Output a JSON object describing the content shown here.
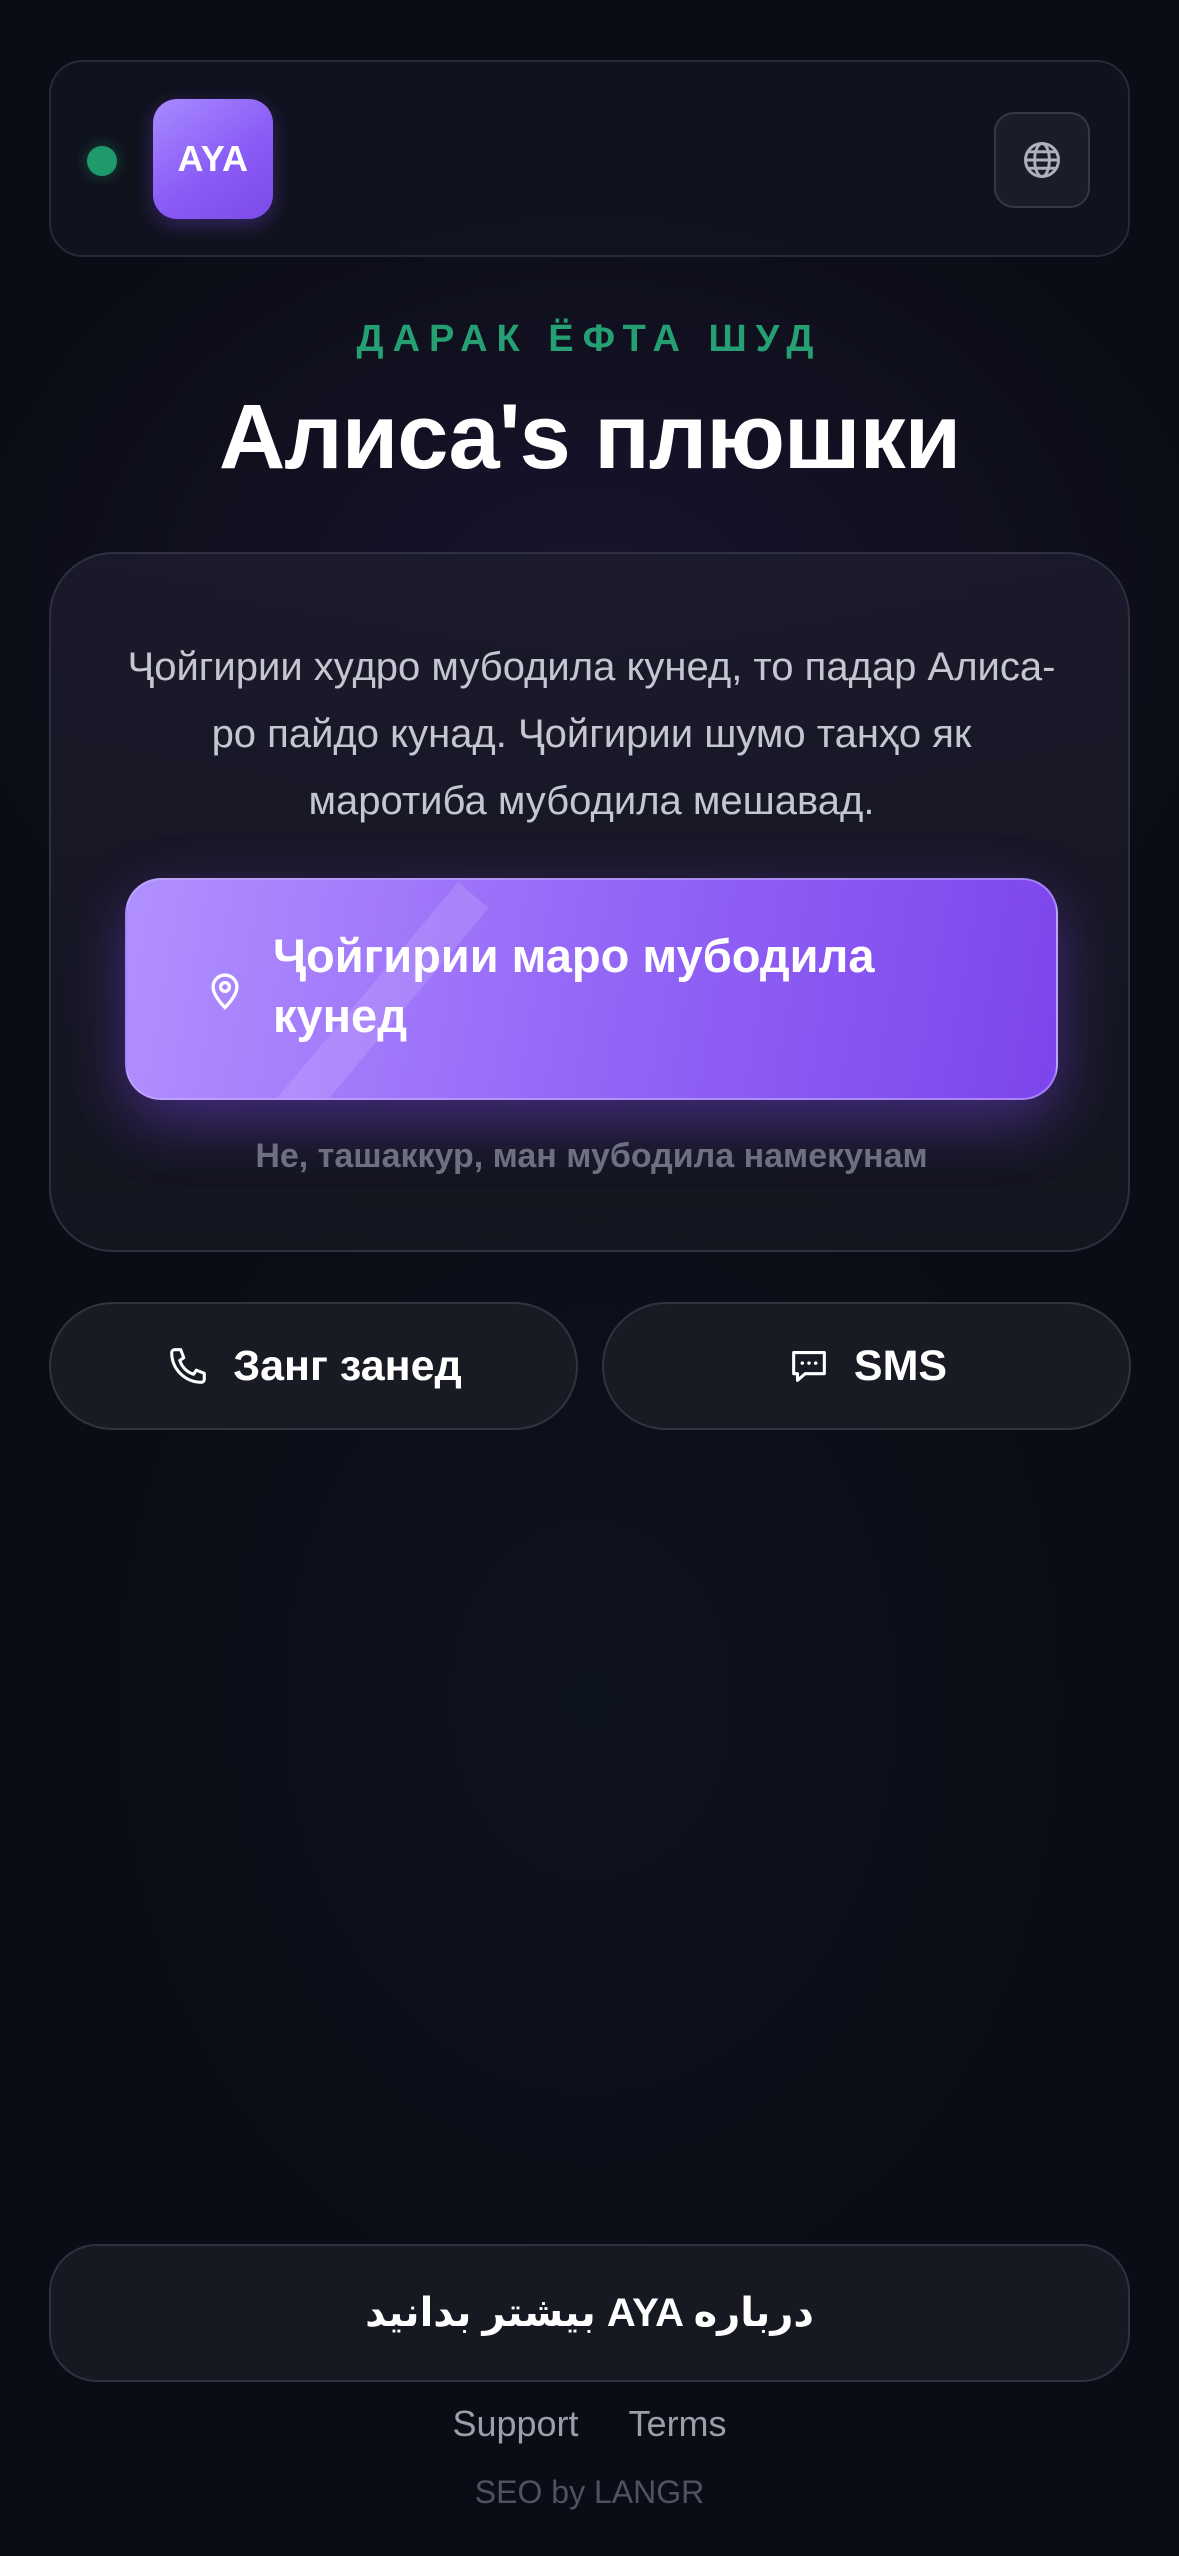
{
  "header": {
    "status": "online",
    "logo_text": "AYA",
    "language_button_icon": "globe-icon"
  },
  "hero": {
    "eyebrow": "ДАРАК ЁФТА ШУД",
    "title": "Алиса's плюшки"
  },
  "card": {
    "description": "Ҷойгирии худро мубодила кунед, то падар Алиса-ро пайдо кунад. Ҷойгирии шумо танҳо як маротиба мубодила мешавад.",
    "primary_button": {
      "label": "Ҷойгирии маро мубодила кунед",
      "icon": "location-pin-icon"
    },
    "decline_link": "Не, ташаккур, ман мубодила намекунам"
  },
  "contact": {
    "call_label": "Занг занед",
    "call_icon": "phone-icon",
    "sms_label": "SMS",
    "sms_icon": "chat-bubble-icon"
  },
  "footer": {
    "learn_more": "بیشتر بدانید AYA درباره",
    "links": [
      "Support",
      "Terms"
    ],
    "credit": "SEO by LANGR"
  },
  "colors": {
    "accent": "#8a5cf6",
    "status_green": "#25a073",
    "background": "#0b0d16"
  }
}
